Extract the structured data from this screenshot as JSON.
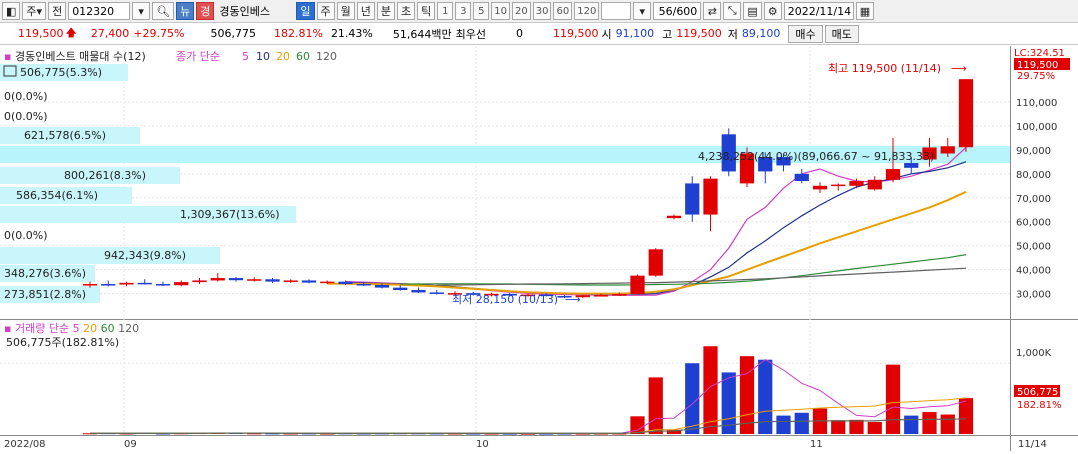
{
  "toolbar": {
    "market_label": "주",
    "period_label": "전",
    "code": "012320",
    "search_icon": "search-icon",
    "news_label": "뉴",
    "warn_label": "경",
    "stock_name": "경동인베스",
    "periods": [
      "일",
      "주",
      "월",
      "년",
      "분",
      "초",
      "틱"
    ],
    "active_period": "일",
    "intervals": [
      "1",
      "3",
      "5",
      "10",
      "20",
      "30",
      "60",
      "120"
    ],
    "count": "56/600",
    "date": "2022/11/14"
  },
  "quote": {
    "price": "119,500",
    "change": "27,400",
    "change_rate": "+29.75%",
    "volume": "506,775",
    "volume_ratio": "182.81%",
    "turnover": "21.43%",
    "amount": "51,644백만",
    "priority_label": "최우선",
    "priority_value": "0",
    "priority_price": "119,500",
    "open_label": "시",
    "open": "91,100",
    "high_label": "고",
    "high": "119,500",
    "low_label": "저",
    "low": "89,100",
    "buy_label": "매수",
    "sell_label": "매도",
    "colors": {
      "up": "#e00000",
      "down": "#1f3fd0",
      "ma5": "#d03ec8",
      "ma10": "#1e2f8f",
      "ma20": "#e8a000",
      "ma60": "#2d8a3a",
      "ma120": "#606060"
    }
  },
  "price_panel": {
    "title": "경동인베스트 매물대 수(12)",
    "ma_label": "종가 단순",
    "ma_periods": [
      "5",
      "10",
      "20",
      "60",
      "120"
    ],
    "lc_label": "LC:324.51",
    "current_price_tag": "119,500",
    "current_pct_tag": "29.75%",
    "high_annotation": "최고 119,500 (11/14)",
    "low_annotation": "최저 28,150 (10/13)",
    "range_annotation": "4,238,252(44.0%)(89,066.67 ~ 91,833.33)",
    "price_axis": [
      "110,000",
      "100,000",
      "90,000",
      "80,000",
      "70,000",
      "60,000",
      "50,000",
      "40,000",
      "30,000"
    ],
    "volume_profile_labels": [
      "506,775(5.3%)",
      "0(0.0%)",
      "0(0.0%)",
      "621,578(6.5%)",
      "800,261(8.3%)",
      "586,354(6.1%)",
      "1,309,367(13.6%)",
      "0(0.0%)",
      "942,343(9.8%)",
      "348,276(3.6%)",
      "273,851(2.8%)"
    ]
  },
  "volume_panel": {
    "title": "거래량",
    "ma_label": "단순",
    "ma_periods": [
      "5",
      "20",
      "60",
      "120"
    ],
    "current_value": "506,775주(182.81%)",
    "axis_label": "1,000K",
    "volume_tag": "506,775",
    "pct_tag": "182.81%"
  },
  "x_axis": {
    "labels": [
      "2022/08",
      "09",
      "10",
      "11",
      "11/14"
    ]
  },
  "chart_data": {
    "type": "candlestick",
    "ylim": [
      24000,
      125000
    ],
    "volume_max": 1300000,
    "candles": [
      {
        "o": 33500,
        "h": 35000,
        "l": 32500,
        "c": 34000,
        "v": 10000
      },
      {
        "o": 34000,
        "h": 35500,
        "l": 33000,
        "c": 33600,
        "v": 12000
      },
      {
        "o": 33800,
        "h": 35000,
        "l": 33000,
        "c": 34500,
        "v": 9000
      },
      {
        "o": 34500,
        "h": 36000,
        "l": 33800,
        "c": 34000,
        "v": 15000
      },
      {
        "o": 34000,
        "h": 35000,
        "l": 33200,
        "c": 33500,
        "v": 8000
      },
      {
        "o": 33500,
        "h": 35500,
        "l": 33000,
        "c": 34800,
        "v": 11000
      },
      {
        "o": 34800,
        "h": 36500,
        "l": 34000,
        "c": 35500,
        "v": 14000
      },
      {
        "o": 35500,
        "h": 38500,
        "l": 35000,
        "c": 36500,
        "v": 20000
      },
      {
        "o": 36500,
        "h": 37000,
        "l": 35000,
        "c": 35600,
        "v": 16000
      },
      {
        "o": 35600,
        "h": 36800,
        "l": 35000,
        "c": 36000,
        "v": 10000
      },
      {
        "o": 36000,
        "h": 36500,
        "l": 34500,
        "c": 35000,
        "v": 9000
      },
      {
        "o": 35000,
        "h": 36000,
        "l": 34500,
        "c": 35500,
        "v": 8000
      },
      {
        "o": 35500,
        "h": 36000,
        "l": 34300,
        "c": 34600,
        "v": 9000
      },
      {
        "o": 34600,
        "h": 35500,
        "l": 34000,
        "c": 35000,
        "v": 7000
      },
      {
        "o": 35000,
        "h": 35500,
        "l": 33600,
        "c": 34000,
        "v": 10000
      },
      {
        "o": 34000,
        "h": 34800,
        "l": 33200,
        "c": 33600,
        "v": 8000
      },
      {
        "o": 33600,
        "h": 34200,
        "l": 32200,
        "c": 32500,
        "v": 9000
      },
      {
        "o": 32500,
        "h": 33500,
        "l": 31200,
        "c": 31500,
        "v": 11000
      },
      {
        "o": 31500,
        "h": 32500,
        "l": 30200,
        "c": 30500,
        "v": 10000
      },
      {
        "o": 30500,
        "h": 31500,
        "l": 29600,
        "c": 30000,
        "v": 9000
      },
      {
        "o": 30000,
        "h": 31000,
        "l": 29400,
        "c": 30200,
        "v": 8000
      },
      {
        "o": 30200,
        "h": 30800,
        "l": 29200,
        "c": 29500,
        "v": 7000
      },
      {
        "o": 29500,
        "h": 30400,
        "l": 28800,
        "c": 29900,
        "v": 7000
      },
      {
        "o": 29900,
        "h": 30300,
        "l": 28900,
        "c": 29200,
        "v": 6000
      },
      {
        "o": 29200,
        "h": 30000,
        "l": 28700,
        "c": 29600,
        "v": 6000
      },
      {
        "o": 29600,
        "h": 30200,
        "l": 28800,
        "c": 29000,
        "v": 6000
      },
      {
        "o": 29000,
        "h": 29500,
        "l": 28150,
        "c": 28500,
        "v": 7000
      },
      {
        "o": 28500,
        "h": 29500,
        "l": 28200,
        "c": 29300,
        "v": 6000
      },
      {
        "o": 29300,
        "h": 30000,
        "l": 28800,
        "c": 29400,
        "v": 7000
      },
      {
        "o": 29400,
        "h": 30500,
        "l": 29000,
        "c": 29800,
        "v": 8000
      },
      {
        "o": 29800,
        "h": 38000,
        "l": 29600,
        "c": 37500,
        "v": 250000
      },
      {
        "o": 37500,
        "h": 49000,
        "l": 37000,
        "c": 48500,
        "v": 800000
      },
      {
        "o": 61500,
        "h": 63000,
        "l": 61000,
        "c": 62500,
        "v": 60000
      },
      {
        "o": 76000,
        "h": 79000,
        "l": 60000,
        "c": 63000,
        "v": 1000000
      },
      {
        "o": 63000,
        "h": 79000,
        "l": 56000,
        "c": 78000,
        "v": 1240000
      },
      {
        "o": 96500,
        "h": 99000,
        "l": 79000,
        "c": 81000,
        "v": 870000
      },
      {
        "o": 76000,
        "h": 91000,
        "l": 74500,
        "c": 88500,
        "v": 1100000
      },
      {
        "o": 87000,
        "h": 89000,
        "l": 76000,
        "c": 81000,
        "v": 1050000
      },
      {
        "o": 87000,
        "h": 88500,
        "l": 81000,
        "c": 83500,
        "v": 260000
      },
      {
        "o": 80000,
        "h": 82000,
        "l": 76000,
        "c": 77000,
        "v": 300000
      },
      {
        "o": 73500,
        "h": 76500,
        "l": 72000,
        "c": 75000,
        "v": 360000
      },
      {
        "o": 75000,
        "h": 76000,
        "l": 73000,
        "c": 75500,
        "v": 195000
      },
      {
        "o": 75000,
        "h": 78000,
        "l": 74000,
        "c": 77000,
        "v": 200000
      },
      {
        "o": 73500,
        "h": 79000,
        "l": 73000,
        "c": 77500,
        "v": 170000
      },
      {
        "o": 77500,
        "h": 95000,
        "l": 76500,
        "c": 82000,
        "v": 980000
      },
      {
        "o": 84500,
        "h": 87000,
        "l": 80000,
        "c": 82500,
        "v": 260000
      },
      {
        "o": 86000,
        "h": 95000,
        "l": 83000,
        "c": 91000,
        "v": 310000
      },
      {
        "o": 88500,
        "h": 95000,
        "l": 87000,
        "c": 91500,
        "v": 275000
      },
      {
        "o": 91100,
        "h": 119500,
        "l": 89100,
        "c": 119500,
        "v": 506775
      }
    ],
    "ma_lines": [
      {
        "period": "5",
        "values": [
          35000,
          34800,
          34500,
          34200,
          33800,
          33400,
          32800,
          32000,
          31200,
          30600,
          30100,
          29800,
          29600,
          29500,
          29400,
          29300,
          29300,
          29400,
          31000,
          35000,
          40000,
          49000,
          61000,
          66000,
          74000,
          80000,
          82000,
          79000,
          77000,
          76500,
          77500,
          79000,
          81500,
          84000,
          91000
        ]
      },
      {
        "period": "10",
        "values": [
          34500,
          34400,
          34200,
          34000,
          33700,
          33300,
          32800,
          32200,
          31600,
          31000,
          30500,
          30200,
          30000,
          29900,
          29800,
          29700,
          29800,
          30000,
          31500,
          33500,
          37000,
          41000,
          47000,
          52000,
          57500,
          62500,
          67000,
          71000,
          74500,
          76500,
          78000,
          80000,
          81000,
          82500,
          85000
        ]
      },
      {
        "period": "20",
        "values": [
          34200,
          34100,
          34000,
          33900,
          33700,
          33400,
          33000,
          32500,
          32000,
          31500,
          31000,
          30600,
          30300,
          30100,
          30000,
          30000,
          30000,
          30200,
          30800,
          31800,
          33500,
          35300,
          37200,
          40000,
          42800,
          45500,
          48200,
          51000,
          53500,
          56000,
          58500,
          61000,
          63500,
          66000,
          69000,
          72500
        ]
      },
      {
        "period": "60",
        "values": [
          34000,
          34000,
          34100,
          34100,
          34100,
          34000,
          34000,
          33900,
          33800,
          33700,
          33600,
          33600,
          33600,
          33700,
          33800,
          33900,
          34100,
          34300,
          34700,
          35200,
          35800,
          36600,
          37500,
          38500,
          39500,
          40500,
          41400,
          42300,
          43200,
          44100,
          45000,
          46300
        ]
      },
      {
        "period": "120",
        "values": [
          33500,
          33600,
          33700,
          33800,
          33900,
          34000,
          34000,
          34100,
          34200,
          34300,
          34400,
          34500,
          34600,
          34800,
          35000,
          35300,
          35600,
          35900,
          36200,
          36600,
          37000,
          37400,
          37800,
          38200,
          38600,
          39000,
          39400,
          39800,
          40200,
          40600
        ]
      }
    ]
  }
}
